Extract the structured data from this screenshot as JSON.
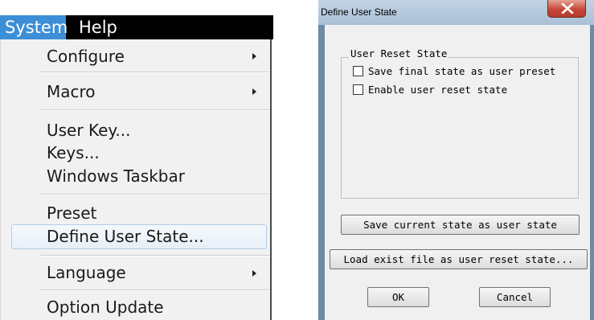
{
  "menu": {
    "menubar": {
      "system": "System",
      "help": "Help"
    },
    "items": {
      "configure": "Configure",
      "macro": "Macro",
      "user_key": "User Key...",
      "keys": "Keys...",
      "windows_taskbar": "Windows Taskbar",
      "preset": "Preset",
      "define_user_state": "Define User State...",
      "language": "Language",
      "option_update": "Option Update"
    },
    "highlighted_item": "Define User State..."
  },
  "dialog": {
    "title": "Define User State",
    "group_title": "User Reset State",
    "checkboxes": [
      {
        "label": "Save final state as user preset",
        "checked": false
      },
      {
        "label": "Enable user reset state",
        "checked": false
      }
    ],
    "buttons": {
      "save_current": "Save current state as user state",
      "load_exist": "Load exist file as user reset state...",
      "ok": "OK",
      "cancel": "Cancel"
    }
  },
  "colors": {
    "menubar_bg": "#000000",
    "menubar_active": "#3c8fd6",
    "menu_bg": "#f1f1f1",
    "highlight_border": "#b4cce6",
    "dialog_frame": "#6e8aa4",
    "close_button": "#c6493a"
  }
}
